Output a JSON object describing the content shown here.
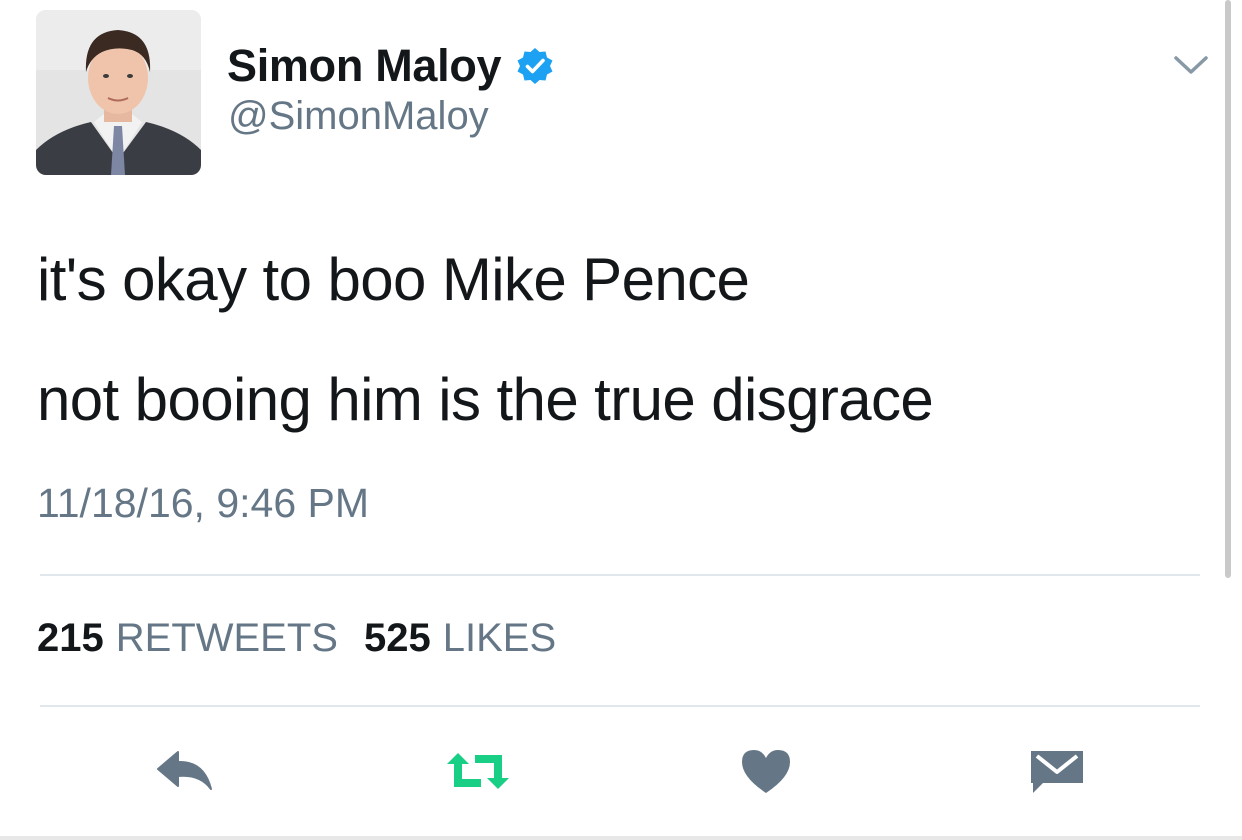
{
  "user": {
    "display_name": "Simon Maloy",
    "handle": "@SimonMaloy",
    "verified": true
  },
  "tweet": {
    "lines": [
      "it's okay to boo Mike Pence",
      "not booing him is the true disgrace"
    ],
    "timestamp": "11/18/16, 9:46 PM"
  },
  "stats": {
    "retweets_count": "215",
    "retweets_label": "RETWEETS",
    "likes_count": "525",
    "likes_label": "LIKES"
  },
  "actions": {
    "reply": "reply-icon",
    "retweet": "retweet-icon",
    "like": "heart-icon",
    "message": "envelope-icon"
  },
  "colors": {
    "verified": "#1da1f2",
    "retweet": "#19cf86",
    "icon_gray": "#657786",
    "text": "#14171a",
    "secondary_text": "#657786"
  }
}
